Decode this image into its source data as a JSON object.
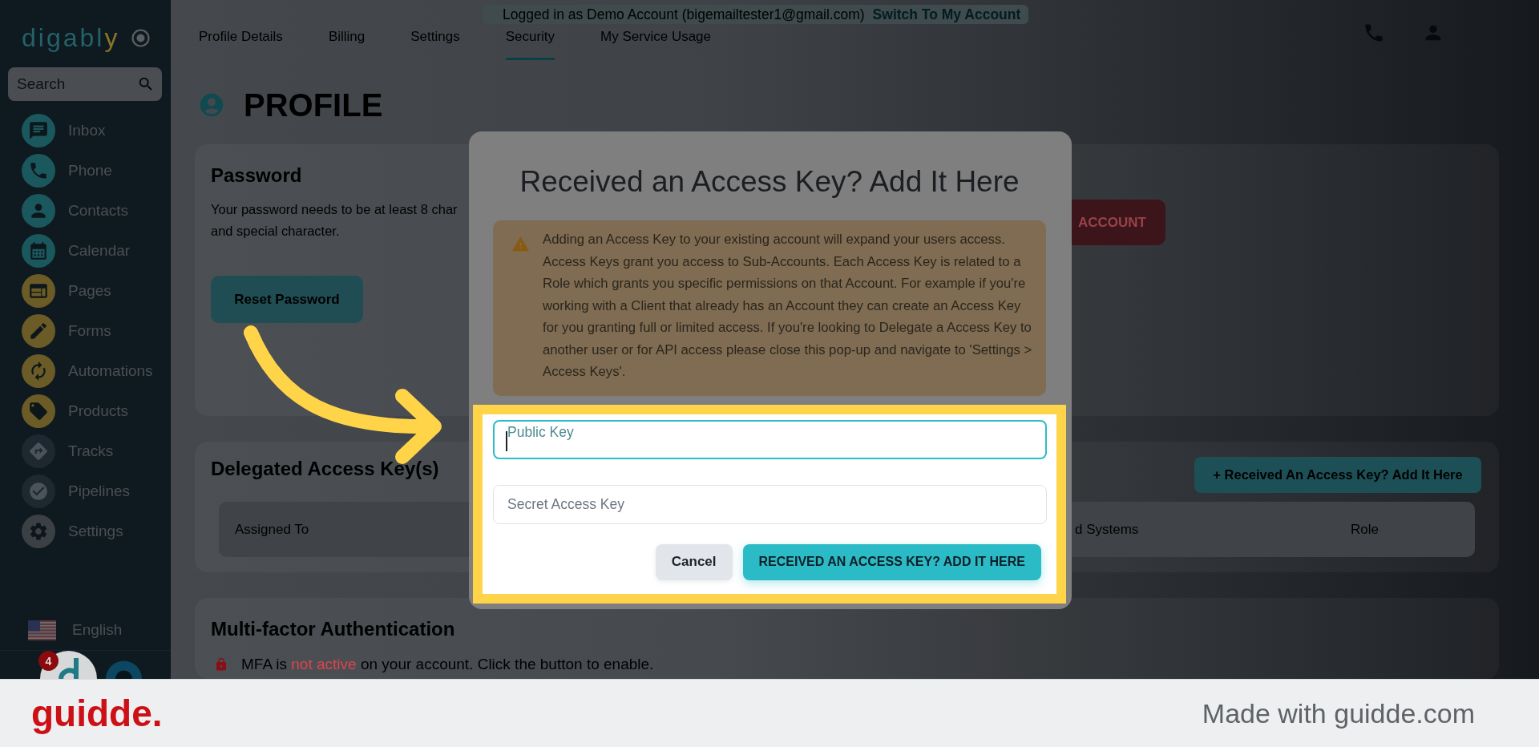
{
  "sidebar": {
    "logo": {
      "text": "digabl",
      "accent": "y"
    },
    "search": {
      "placeholder": "Search"
    },
    "items": [
      {
        "label": "Inbox",
        "color": "#1b585d"
      },
      {
        "label": "Phone",
        "color": "#1b585d"
      },
      {
        "label": "Contacts",
        "color": "#1b585d"
      },
      {
        "label": "Calendar",
        "color": "#1b585d"
      },
      {
        "label": "Pages",
        "color": "#6b5b26"
      },
      {
        "label": "Forms",
        "color": "#6b5b26"
      },
      {
        "label": "Automations",
        "color": "#6b5b26"
      },
      {
        "label": "Products",
        "color": "#6b5b26"
      },
      {
        "label": "Tracks",
        "color": "#1d2831"
      },
      {
        "label": "Pipelines",
        "color": "#1d2831"
      },
      {
        "label": "Settings",
        "color": "#3b4045"
      }
    ],
    "language": "English",
    "notification_count": "4"
  },
  "top_bar": {
    "login_notice": "Logged in as Demo Account (bigemailtester1@gmail.com)",
    "switch_link": "Switch To My Account",
    "tabs": [
      {
        "label": "Profile Details",
        "selected": false
      },
      {
        "label": "Billing",
        "selected": false
      },
      {
        "label": "Settings",
        "selected": false
      },
      {
        "label": "Security",
        "selected": true
      },
      {
        "label": "My Service Usage",
        "selected": false
      }
    ]
  },
  "page": {
    "title": "PROFILE",
    "password_card": {
      "title": "Password",
      "description_lines": [
        "Your password needs to be at least 8 char",
        "and special character."
      ],
      "button": "Reset Password",
      "side_button": "ACCOUNT"
    },
    "delegated_card": {
      "title": "Delegated Access Key(s)",
      "add_button": "+ Received An Access Key? Add It Here",
      "columns": [
        "Assigned To",
        "d Systems",
        "Role"
      ]
    },
    "mfa_card": {
      "title": "Multi-factor Authentication",
      "status": {
        "before": "MFA is",
        "highlight": "not active",
        "after": "on your account. Click the button to enable."
      }
    }
  },
  "modal": {
    "title": "Received an Access Key? Add It Here",
    "notice": "Adding an Access Key to your existing account will expand your users access. Access Keys grant you access to Sub-Accounts. Each Access Key is related to a Role which grants you specific permissions on that Account. For example if you're working with a Client that already has an Account they can create an Access Key for you granting full or limited access. If you're looking to Delegate a Access Key to another user or for API access please close this pop-up and navigate to 'Settings > Access Keys'.",
    "fields": [
      {
        "placeholder": "Public Key",
        "focused": true
      },
      {
        "placeholder": "Secret Access Key",
        "focused": false
      }
    ],
    "buttons": [
      {
        "label": "Cancel",
        "kind": "secondary"
      },
      {
        "label": "RECEIVED AN ACCESS KEY? ADD IT HERE",
        "kind": "primary"
      }
    ]
  },
  "footer": {
    "brand": "guidde.",
    "credit": "Made with guidde.com"
  }
}
